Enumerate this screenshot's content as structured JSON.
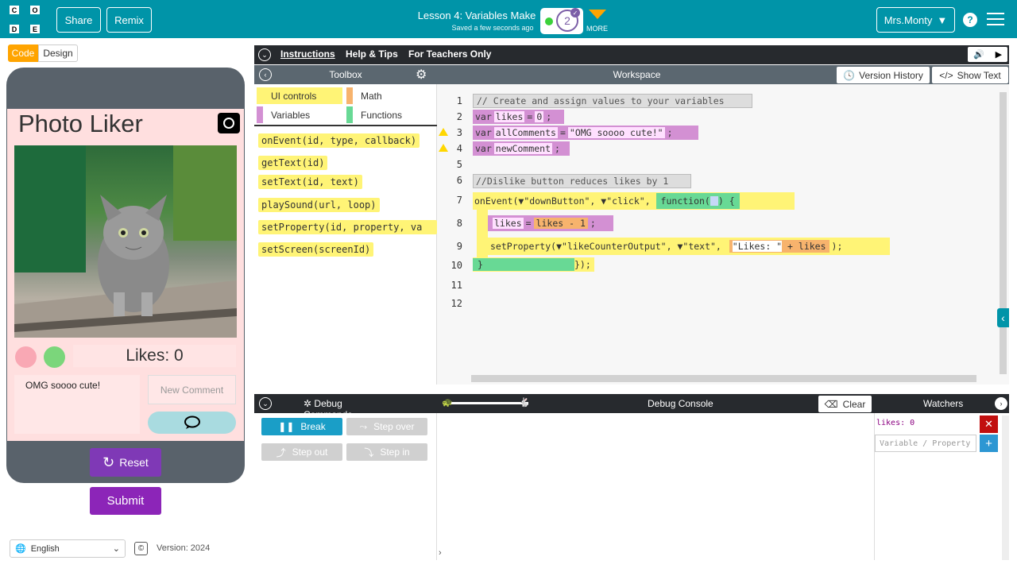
{
  "header": {
    "share": "Share",
    "remix": "Remix",
    "lesson_title": "Lesson 4: Variables Make",
    "saved_status": "Saved a few seconds ago",
    "level": "2",
    "more": "MORE",
    "user": "Mrs.Monty",
    "help": "?"
  },
  "logo": {
    "letters": [
      "C",
      "O",
      "D",
      "E"
    ]
  },
  "left": {
    "code_tab": "Code",
    "design_tab": "Design"
  },
  "app": {
    "title": "Photo Liker",
    "likes_label": "Likes: 0",
    "comment_text": "OMG soooo cute!",
    "new_comment_placeholder": "New Comment",
    "reset": "Reset",
    "submit": "Submit"
  },
  "footer": {
    "language": "English",
    "version": "Version: 2024"
  },
  "instructions_bar": {
    "tabs": [
      "Instructions",
      "Help & Tips",
      "For Teachers Only"
    ]
  },
  "toolbox": {
    "title": "Toolbox",
    "categories": [
      {
        "label": "UI controls",
        "color": "#fff476"
      },
      {
        "label": "Math",
        "color": "#f7b36d"
      },
      {
        "label": "Variables",
        "color": "#d390d3"
      },
      {
        "label": "Functions",
        "color": "#68d995"
      }
    ],
    "blocks": [
      "onEvent(id, type, callback)",
      "getText(id)",
      "setText(id, text)",
      "playSound(url, loop)",
      "setProperty(id, property, va",
      "setScreen(screenId)"
    ]
  },
  "workspace": {
    "title": "Workspace",
    "version_history": "Version History",
    "show_text": "Show Text",
    "lines": [
      "1",
      "2",
      "3",
      "4",
      "5",
      "6",
      "7",
      "8",
      "9",
      "10",
      "11",
      "12"
    ],
    "code": {
      "comment1": "// Create and assign values to your variables",
      "var_kw": "var",
      "likes": "likes",
      "zero": "0",
      "allComments": "allComments",
      "omg": "\"OMG soooo cute!\"",
      "newComment": "newComment",
      "comment2": "//Dislike button reduces likes by 1",
      "onEvent": "onEvent(",
      "downButton": "\"downButton\",",
      "click": "\"click\",",
      "function_kw": "function(",
      "brace_open": ") {",
      "minus_one": "likes - 1",
      "setProperty": "setProperty(",
      "likeCounter": "\"likeCounterOutput\",",
      "text_arg": "\"text\",",
      "likes_str": "\"Likes: \"",
      "plus_likes": "+ likes",
      "close": "});"
    }
  },
  "debug": {
    "commands": "Debug Commands",
    "console": "Debug Console",
    "clear": "Clear",
    "watchers": "Watchers",
    "break": "Break",
    "step_over": "Step over",
    "step_out": "Step out",
    "step_in": "Step in",
    "watch_value": "likes: 0",
    "watch_placeholder": "Variable / Property"
  },
  "colors": {
    "brand": "#0094a8",
    "ui_controls": "#fff476",
    "variables": "#d390d3",
    "functions": "#68d995",
    "math": "#f7b36d",
    "purple": "#8c25b8"
  }
}
